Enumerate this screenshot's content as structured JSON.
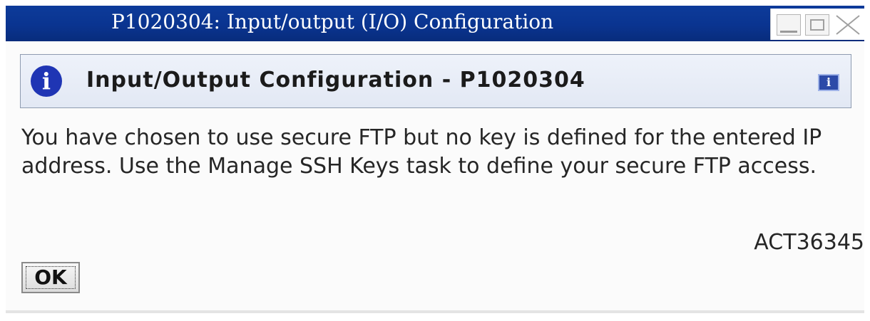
{
  "window": {
    "title": "P1020304: Input/output (I/O) Configuration"
  },
  "header": {
    "title": "Input/Output Configuration - P1020304",
    "icon": "info-icon",
    "help_icon": "help-icon"
  },
  "message": {
    "text": "You have chosen to use secure FTP but no key is defined for the entered IP address. Use the Manage SSH Keys task to define your secure FTP access.",
    "code": "ACT36345"
  },
  "buttons": {
    "ok_label": "OK"
  },
  "colors": {
    "titlebar": "#0a3490",
    "info_icon": "#1f35b4",
    "header_panel": "#e6ebf6"
  }
}
